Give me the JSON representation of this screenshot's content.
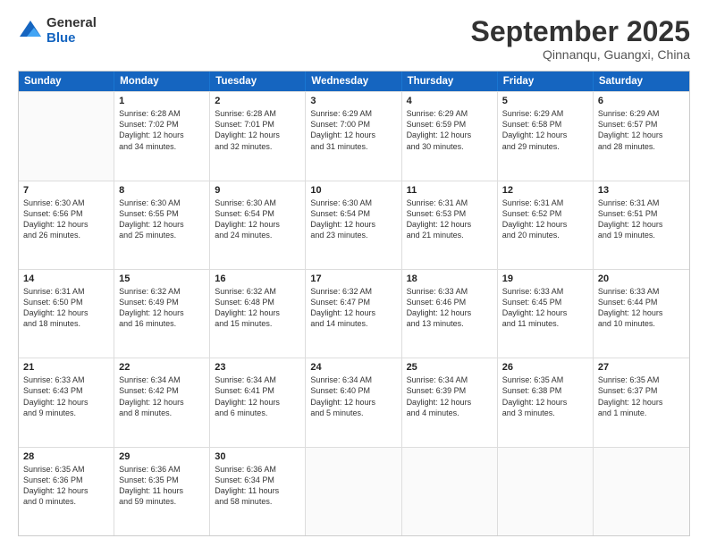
{
  "header": {
    "logo": {
      "general": "General",
      "blue": "Blue"
    },
    "title": "September 2025",
    "location": "Qinnanqu, Guangxi, China"
  },
  "calendar": {
    "days": [
      "Sunday",
      "Monday",
      "Tuesday",
      "Wednesday",
      "Thursday",
      "Friday",
      "Saturday"
    ],
    "rows": [
      [
        {
          "num": "",
          "text": ""
        },
        {
          "num": "1",
          "text": "Sunrise: 6:28 AM\nSunset: 7:02 PM\nDaylight: 12 hours\nand 34 minutes."
        },
        {
          "num": "2",
          "text": "Sunrise: 6:28 AM\nSunset: 7:01 PM\nDaylight: 12 hours\nand 32 minutes."
        },
        {
          "num": "3",
          "text": "Sunrise: 6:29 AM\nSunset: 7:00 PM\nDaylight: 12 hours\nand 31 minutes."
        },
        {
          "num": "4",
          "text": "Sunrise: 6:29 AM\nSunset: 6:59 PM\nDaylight: 12 hours\nand 30 minutes."
        },
        {
          "num": "5",
          "text": "Sunrise: 6:29 AM\nSunset: 6:58 PM\nDaylight: 12 hours\nand 29 minutes."
        },
        {
          "num": "6",
          "text": "Sunrise: 6:29 AM\nSunset: 6:57 PM\nDaylight: 12 hours\nand 28 minutes."
        }
      ],
      [
        {
          "num": "7",
          "text": "Sunrise: 6:30 AM\nSunset: 6:56 PM\nDaylight: 12 hours\nand 26 minutes."
        },
        {
          "num": "8",
          "text": "Sunrise: 6:30 AM\nSunset: 6:55 PM\nDaylight: 12 hours\nand 25 minutes."
        },
        {
          "num": "9",
          "text": "Sunrise: 6:30 AM\nSunset: 6:54 PM\nDaylight: 12 hours\nand 24 minutes."
        },
        {
          "num": "10",
          "text": "Sunrise: 6:30 AM\nSunset: 6:54 PM\nDaylight: 12 hours\nand 23 minutes."
        },
        {
          "num": "11",
          "text": "Sunrise: 6:31 AM\nSunset: 6:53 PM\nDaylight: 12 hours\nand 21 minutes."
        },
        {
          "num": "12",
          "text": "Sunrise: 6:31 AM\nSunset: 6:52 PM\nDaylight: 12 hours\nand 20 minutes."
        },
        {
          "num": "13",
          "text": "Sunrise: 6:31 AM\nSunset: 6:51 PM\nDaylight: 12 hours\nand 19 minutes."
        }
      ],
      [
        {
          "num": "14",
          "text": "Sunrise: 6:31 AM\nSunset: 6:50 PM\nDaylight: 12 hours\nand 18 minutes."
        },
        {
          "num": "15",
          "text": "Sunrise: 6:32 AM\nSunset: 6:49 PM\nDaylight: 12 hours\nand 16 minutes."
        },
        {
          "num": "16",
          "text": "Sunrise: 6:32 AM\nSunset: 6:48 PM\nDaylight: 12 hours\nand 15 minutes."
        },
        {
          "num": "17",
          "text": "Sunrise: 6:32 AM\nSunset: 6:47 PM\nDaylight: 12 hours\nand 14 minutes."
        },
        {
          "num": "18",
          "text": "Sunrise: 6:33 AM\nSunset: 6:46 PM\nDaylight: 12 hours\nand 13 minutes."
        },
        {
          "num": "19",
          "text": "Sunrise: 6:33 AM\nSunset: 6:45 PM\nDaylight: 12 hours\nand 11 minutes."
        },
        {
          "num": "20",
          "text": "Sunrise: 6:33 AM\nSunset: 6:44 PM\nDaylight: 12 hours\nand 10 minutes."
        }
      ],
      [
        {
          "num": "21",
          "text": "Sunrise: 6:33 AM\nSunset: 6:43 PM\nDaylight: 12 hours\nand 9 minutes."
        },
        {
          "num": "22",
          "text": "Sunrise: 6:34 AM\nSunset: 6:42 PM\nDaylight: 12 hours\nand 8 minutes."
        },
        {
          "num": "23",
          "text": "Sunrise: 6:34 AM\nSunset: 6:41 PM\nDaylight: 12 hours\nand 6 minutes."
        },
        {
          "num": "24",
          "text": "Sunrise: 6:34 AM\nSunset: 6:40 PM\nDaylight: 12 hours\nand 5 minutes."
        },
        {
          "num": "25",
          "text": "Sunrise: 6:34 AM\nSunset: 6:39 PM\nDaylight: 12 hours\nand 4 minutes."
        },
        {
          "num": "26",
          "text": "Sunrise: 6:35 AM\nSunset: 6:38 PM\nDaylight: 12 hours\nand 3 minutes."
        },
        {
          "num": "27",
          "text": "Sunrise: 6:35 AM\nSunset: 6:37 PM\nDaylight: 12 hours\nand 1 minute."
        }
      ],
      [
        {
          "num": "28",
          "text": "Sunrise: 6:35 AM\nSunset: 6:36 PM\nDaylight: 12 hours\nand 0 minutes."
        },
        {
          "num": "29",
          "text": "Sunrise: 6:36 AM\nSunset: 6:35 PM\nDaylight: 11 hours\nand 59 minutes."
        },
        {
          "num": "30",
          "text": "Sunrise: 6:36 AM\nSunset: 6:34 PM\nDaylight: 11 hours\nand 58 minutes."
        },
        {
          "num": "",
          "text": ""
        },
        {
          "num": "",
          "text": ""
        },
        {
          "num": "",
          "text": ""
        },
        {
          "num": "",
          "text": ""
        }
      ]
    ]
  }
}
